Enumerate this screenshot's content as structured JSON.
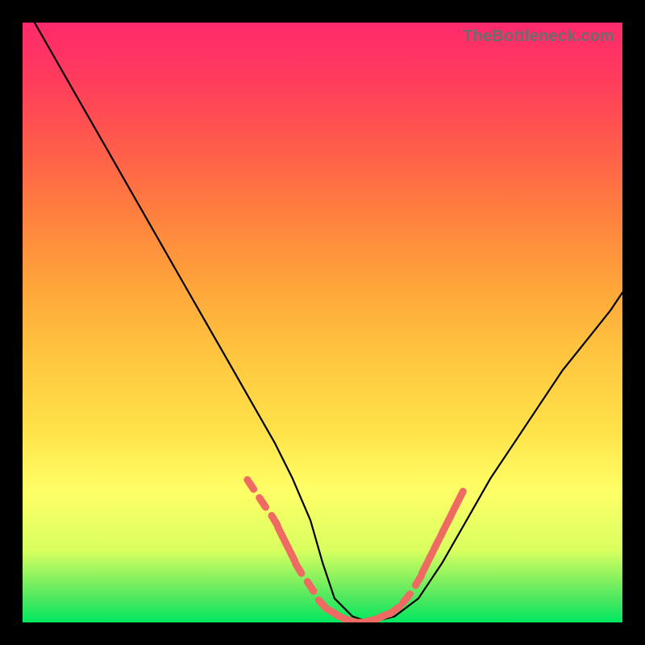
{
  "watermark": "TheBottleneck.com",
  "chart_data": {
    "type": "line",
    "title": "",
    "xlabel": "",
    "ylabel": "",
    "xlim": [
      0,
      100
    ],
    "ylim": [
      0,
      100
    ],
    "grid": false,
    "legend": false,
    "series": [
      {
        "name": "bottleneck-curve",
        "x": [
          2,
          6,
          10,
          14,
          18,
          22,
          26,
          30,
          34,
          38,
          42,
          45,
          48,
          50,
          52,
          55,
          58,
          62,
          66,
          70,
          74,
          78,
          82,
          86,
          90,
          94,
          98,
          100
        ],
        "values": [
          100,
          93,
          86,
          79,
          72,
          65,
          58,
          51,
          44,
          37,
          30,
          24,
          17,
          10,
          4,
          1,
          0,
          1,
          4,
          10,
          17,
          24,
          30,
          36,
          42,
          47,
          52,
          55
        ]
      }
    ],
    "markers": {
      "name": "highlight-dots",
      "color": "#ee6a62",
      "points": [
        {
          "x": 38,
          "y": 23
        },
        {
          "x": 40,
          "y": 20
        },
        {
          "x": 42,
          "y": 17
        },
        {
          "x": 43,
          "y": 15
        },
        {
          "x": 44,
          "y": 13
        },
        {
          "x": 45,
          "y": 11
        },
        {
          "x": 46,
          "y": 9
        },
        {
          "x": 48,
          "y": 6
        },
        {
          "x": 50,
          "y": 3
        },
        {
          "x": 52,
          "y": 1.5
        },
        {
          "x": 54,
          "y": 0.5
        },
        {
          "x": 56,
          "y": 0
        },
        {
          "x": 58,
          "y": 0.3
        },
        {
          "x": 60,
          "y": 1
        },
        {
          "x": 62,
          "y": 2
        },
        {
          "x": 64,
          "y": 4
        },
        {
          "x": 66,
          "y": 7
        },
        {
          "x": 67,
          "y": 9
        },
        {
          "x": 68,
          "y": 11
        },
        {
          "x": 69,
          "y": 13
        },
        {
          "x": 70,
          "y": 15
        },
        {
          "x": 71,
          "y": 17
        },
        {
          "x": 72,
          "y": 19
        },
        {
          "x": 73,
          "y": 21
        }
      ]
    }
  }
}
